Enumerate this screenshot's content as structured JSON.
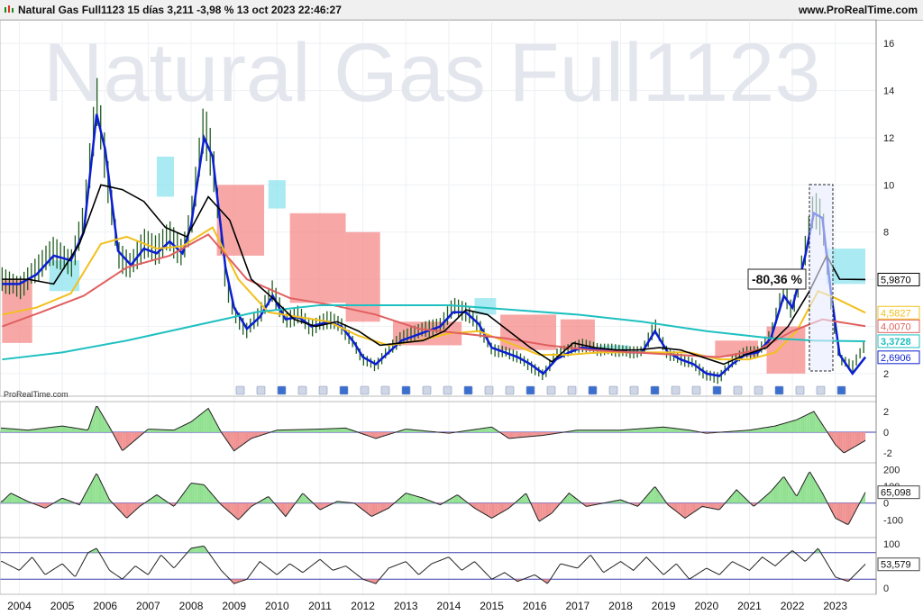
{
  "header": {
    "title": "Natural Gas Full1123 15 días 3,211 -3,98 % 13 oct 2023 22:46:27",
    "site": "www.ProRealTime.com",
    "watermark": "Natural Gas Full1123",
    "credit": "ProRealTime.com"
  },
  "chart_data": [
    {
      "type": "line",
      "panel": "price",
      "title": "Natural Gas Full1123",
      "x_unit": "year",
      "ylim": [
        1.5,
        17
      ],
      "y_ticks": [
        "2",
        "4",
        "6",
        "8",
        "10",
        "12",
        "14",
        "16"
      ],
      "x_ticks": [
        "2004",
        "2005",
        "2006",
        "2007",
        "2008",
        "2009",
        "2010",
        "2011",
        "2012",
        "2013",
        "2014",
        "2015",
        "2016",
        "2017",
        "2018",
        "2019",
        "2020",
        "2021",
        "2022",
        "2023"
      ],
      "series": [
        {
          "name": "price",
          "color": "#1f5c1f",
          "x": [
            2003.6,
            2004.0,
            2004.4,
            2004.8,
            2005.2,
            2005.5,
            2005.8,
            2006.0,
            2006.3,
            2006.6,
            2006.9,
            2007.2,
            2007.5,
            2007.8,
            2008.0,
            2008.3,
            2008.5,
            2008.8,
            2009.0,
            2009.3,
            2009.6,
            2009.9,
            2010.2,
            2010.5,
            2010.8,
            2011.2,
            2011.5,
            2011.8,
            2012.0,
            2012.3,
            2012.6,
            2012.9,
            2013.2,
            2013.5,
            2013.8,
            2014.1,
            2014.4,
            2014.7,
            2015.0,
            2015.3,
            2015.6,
            2015.9,
            2016.2,
            2016.5,
            2016.8,
            2017.1,
            2017.5,
            2017.8,
            2018.2,
            2018.5,
            2018.8,
            2019.1,
            2019.4,
            2019.7,
            2020.0,
            2020.3,
            2020.6,
            2020.9,
            2021.2,
            2021.5,
            2021.8,
            2022.0,
            2022.3,
            2022.5,
            2022.7,
            2022.9,
            2023.1,
            2023.4,
            2023.7
          ],
          "y": [
            6.0,
            5.6,
            6.4,
            7.2,
            6.6,
            8.5,
            13.5,
            11.0,
            7.0,
            6.5,
            7.5,
            7.2,
            7.8,
            7.0,
            8.5,
            12.5,
            11.0,
            6.0,
            4.5,
            3.8,
            4.5,
            5.5,
            4.2,
            4.5,
            3.9,
            4.3,
            4.0,
            3.2,
            2.6,
            2.3,
            3.0,
            3.5,
            3.7,
            3.9,
            4.0,
            4.8,
            4.6,
            4.0,
            3.0,
            2.9,
            2.7,
            2.3,
            1.9,
            2.8,
            3.0,
            3.2,
            3.0,
            3.0,
            2.9,
            2.9,
            4.0,
            2.8,
            2.6,
            2.4,
            1.9,
            1.8,
            2.5,
            2.9,
            2.9,
            3.6,
            5.6,
            4.5,
            7.2,
            9.0,
            8.5,
            5.0,
            2.6,
            2.3,
            3.2
          ]
        },
        {
          "name": "MA1",
          "color": "#0b1fd1",
          "x": [
            2003.6,
            2004.0,
            2004.4,
            2004.8,
            2005.2,
            2005.5,
            2005.8,
            2006.0,
            2006.3,
            2006.6,
            2006.9,
            2007.2,
            2007.5,
            2007.8,
            2008.0,
            2008.3,
            2008.5,
            2008.8,
            2009.0,
            2009.3,
            2009.6,
            2009.9,
            2010.2,
            2010.5,
            2010.8,
            2011.2,
            2011.5,
            2011.8,
            2012.0,
            2012.3,
            2012.6,
            2012.9,
            2013.2,
            2013.5,
            2013.8,
            2014.1,
            2014.4,
            2014.7,
            2015.0,
            2015.3,
            2015.6,
            2015.9,
            2016.2,
            2016.5,
            2016.8,
            2017.1,
            2017.5,
            2017.8,
            2018.2,
            2018.5,
            2018.8,
            2019.1,
            2019.4,
            2019.7,
            2020.0,
            2020.3,
            2020.6,
            2020.9,
            2021.2,
            2021.5,
            2021.8,
            2022.0,
            2022.3,
            2022.5,
            2022.7,
            2022.9,
            2023.1,
            2023.4,
            2023.7
          ],
          "y": [
            5.8,
            5.8,
            6.2,
            7.0,
            6.8,
            8.0,
            13.0,
            11.5,
            7.2,
            6.6,
            7.3,
            7.1,
            7.6,
            7.1,
            8.3,
            12.0,
            11.2,
            6.5,
            4.8,
            3.9,
            4.4,
            5.3,
            4.3,
            4.4,
            4.0,
            4.2,
            4.0,
            3.3,
            2.7,
            2.4,
            2.9,
            3.4,
            3.6,
            3.8,
            4.0,
            4.6,
            4.6,
            4.1,
            3.1,
            2.9,
            2.7,
            2.4,
            2.0,
            2.6,
            2.9,
            3.1,
            3.0,
            3.0,
            2.9,
            2.9,
            3.8,
            2.9,
            2.6,
            2.4,
            2.0,
            1.9,
            2.4,
            2.8,
            2.9,
            3.5,
            5.3,
            4.8,
            7.0,
            8.8,
            8.6,
            5.4,
            2.8,
            2.0,
            2.7
          ]
        },
        {
          "name": "MA2",
          "color": "#f2c01d",
          "x": [
            2003.6,
            2004.4,
            2005.2,
            2005.9,
            2006.5,
            2007.2,
            2007.8,
            2008.5,
            2009.1,
            2009.8,
            2010.5,
            2011.2,
            2011.9,
            2012.6,
            2013.3,
            2014.0,
            2014.7,
            2015.4,
            2016.1,
            2016.8,
            2017.5,
            2018.2,
            2018.9,
            2019.6,
            2020.3,
            2021.0,
            2021.6,
            2022.1,
            2022.6,
            2023.0,
            2023.7
          ],
          "y": [
            4.5,
            4.8,
            5.4,
            7.5,
            7.8,
            7.3,
            7.4,
            8.2,
            6.0,
            4.6,
            4.4,
            4.2,
            3.6,
            3.2,
            3.4,
            3.7,
            3.8,
            3.3,
            2.8,
            2.8,
            2.9,
            2.9,
            2.9,
            2.9,
            2.6,
            2.6,
            2.9,
            3.8,
            5.5,
            5.2,
            4.58
          ]
        },
        {
          "name": "MA3",
          "color": "#e06060",
          "x": [
            2003.6,
            2004.5,
            2005.5,
            2006.5,
            2007.5,
            2008.4,
            2009.3,
            2010.3,
            2011.3,
            2012.3,
            2013.3,
            2014.3,
            2015.3,
            2016.3,
            2017.3,
            2018.3,
            2019.3,
            2020.3,
            2021.2,
            2022.0,
            2022.7,
            2023.7
          ],
          "y": [
            4.0,
            4.6,
            5.3,
            6.5,
            7.0,
            7.9,
            6.0,
            5.2,
            4.9,
            4.5,
            3.9,
            3.7,
            3.5,
            3.2,
            3.0,
            2.9,
            2.8,
            2.7,
            3.0,
            3.8,
            4.3,
            4.01
          ]
        },
        {
          "name": "MA4",
          "color": "#1fc0c0",
          "x": [
            2003.6,
            2005.0,
            2006.5,
            2008.0,
            2009.5,
            2011.0,
            2012.5,
            2014.0,
            2015.5,
            2017.0,
            2018.5,
            2020.0,
            2021.5,
            2022.5,
            2023.7
          ],
          "y": [
            2.6,
            2.9,
            3.4,
            4.0,
            4.6,
            4.9,
            4.9,
            4.9,
            4.7,
            4.5,
            4.2,
            3.8,
            3.5,
            3.4,
            3.37
          ]
        },
        {
          "name": "kijun",
          "color": "#000000",
          "x": [
            2003.6,
            2004.2,
            2004.8,
            2005.4,
            2005.9,
            2006.4,
            2006.9,
            2007.4,
            2007.9,
            2008.4,
            2008.9,
            2009.4,
            2009.9,
            2010.4,
            2010.9,
            2011.4,
            2011.9,
            2012.4,
            2012.9,
            2013.4,
            2013.9,
            2014.4,
            2014.9,
            2015.4,
            2015.9,
            2016.4,
            2016.9,
            2017.4,
            2017.9,
            2018.4,
            2018.9,
            2019.4,
            2019.9,
            2020.4,
            2020.9,
            2021.4,
            2021.9,
            2022.4,
            2022.8,
            2023.1,
            2023.7
          ],
          "y": [
            6.0,
            6.0,
            5.8,
            7.5,
            10.0,
            9.8,
            9.3,
            8.2,
            7.8,
            9.5,
            8.5,
            6.0,
            5.2,
            4.3,
            4.0,
            4.2,
            3.8,
            3.2,
            3.3,
            3.4,
            3.8,
            4.7,
            4.5,
            3.8,
            3.1,
            2.5,
            3.3,
            3.1,
            3.0,
            3.0,
            3.1,
            3.0,
            2.7,
            2.4,
            2.8,
            3.1,
            4.0,
            5.5,
            7.0,
            6.0,
            5.99
          ]
        }
      ],
      "cloud": [
        {
          "type": "bear",
          "x": [
            2003.6,
            2004.3
          ],
          "low": 3.3,
          "high": 6.0
        },
        {
          "type": "bull",
          "x": [
            2004.7,
            2005.4
          ],
          "low": 5.5,
          "high": 6.8
        },
        {
          "type": "bull",
          "x": [
            2007.2,
            2007.6
          ],
          "low": 9.5,
          "high": 11.2
        },
        {
          "type": "bear",
          "x": [
            2008.6,
            2009.7
          ],
          "low": 7.0,
          "high": 10.0
        },
        {
          "type": "bull",
          "x": [
            2009.8,
            2010.2
          ],
          "low": 9.0,
          "high": 10.2
        },
        {
          "type": "bear",
          "x": [
            2010.3,
            2011.6
          ],
          "low": 5.0,
          "high": 8.8
        },
        {
          "type": "bear",
          "x": [
            2011.6,
            2012.4
          ],
          "low": 4.2,
          "high": 8.0
        },
        {
          "type": "bear",
          "x": [
            2012.7,
            2014.3
          ],
          "low": 3.2,
          "high": 4.2
        },
        {
          "type": "bull",
          "x": [
            2014.6,
            2015.1
          ],
          "low": 4.5,
          "high": 5.2
        },
        {
          "type": "bear",
          "x": [
            2015.2,
            2016.5
          ],
          "low": 3.0,
          "high": 4.5
        },
        {
          "type": "bear",
          "x": [
            2016.6,
            2017.4
          ],
          "low": 3.0,
          "high": 4.3
        },
        {
          "type": "bull",
          "x": [
            2017.5,
            2018.2
          ],
          "low": 2.9,
          "high": 3.2
        },
        {
          "type": "bear",
          "x": [
            2020.2,
            2021.2
          ],
          "low": 2.7,
          "high": 3.4
        },
        {
          "type": "bear",
          "x": [
            2021.4,
            2022.3
          ],
          "low": 2.0,
          "high": 4.0
        },
        {
          "type": "bull",
          "x": [
            2022.8,
            2023.7
          ],
          "low": 5.8,
          "high": 7.3
        }
      ],
      "price_labels": [
        {
          "value": "5,9870",
          "color": "#000000"
        },
        {
          "value": "4,5827",
          "color": "#f2c01d"
        },
        {
          "value": "4,0070",
          "color": "#e06060"
        },
        {
          "value": "3,3728",
          "color": "#1fc0c0"
        },
        {
          "value": "2,6906",
          "color": "#0b1fd1"
        }
      ],
      "annotation": "-80,36 %"
    },
    {
      "type": "area",
      "panel": "oscillator-1",
      "ylim": [
        -2.6,
        2.6
      ],
      "y_ticks": [
        "2",
        "0",
        "-2"
      ],
      "x": [
        2003.6,
        2004.2,
        2005.0,
        2005.6,
        2005.8,
        2006.1,
        2006.4,
        2007.0,
        2007.6,
        2008.0,
        2008.4,
        2008.7,
        2009.0,
        2009.4,
        2010.0,
        2011.0,
        2011.6,
        2012.3,
        2013.0,
        2014.0,
        2015.0,
        2015.4,
        2016.2,
        2017.0,
        2018.0,
        2019.0,
        2019.6,
        2020.0,
        2021.0,
        2021.6,
        2022.1,
        2022.5,
        2022.8,
        2023.0,
        2023.2,
        2023.7
      ],
      "y": [
        0.4,
        0.2,
        0.6,
        0.2,
        2.6,
        0.5,
        -1.8,
        0.3,
        0.2,
        1.0,
        2.3,
        0.0,
        -1.8,
        -0.6,
        0.2,
        0.3,
        0.4,
        -0.6,
        0.3,
        -0.1,
        0.5,
        -0.6,
        -0.3,
        0.2,
        0.2,
        0.5,
        0.2,
        -0.1,
        0.2,
        0.6,
        1.2,
        2.0,
        0.1,
        -1.2,
        -2.0,
        -0.8
      ]
    },
    {
      "type": "area",
      "panel": "oscillator-2",
      "ylim": [
        -190,
        225
      ],
      "y_ticks": [
        "200",
        "100",
        "0",
        "-100"
      ],
      "value_label": "65,098",
      "x": [
        2003.6,
        2003.8,
        2004.2,
        2004.6,
        2005.0,
        2005.4,
        2005.8,
        2006.1,
        2006.5,
        2006.8,
        2007.2,
        2007.6,
        2008.0,
        2008.3,
        2008.7,
        2009.1,
        2009.4,
        2009.8,
        2010.2,
        2010.6,
        2011.0,
        2011.4,
        2011.8,
        2012.2,
        2012.6,
        2013.0,
        2013.4,
        2013.8,
        2014.2,
        2014.6,
        2015.0,
        2015.4,
        2015.8,
        2016.1,
        2016.4,
        2016.8,
        2017.2,
        2017.6,
        2018.0,
        2018.4,
        2018.8,
        2019.1,
        2019.5,
        2019.9,
        2020.3,
        2020.7,
        2021.1,
        2021.5,
        2021.8,
        2022.1,
        2022.4,
        2022.7,
        2023.0,
        2023.3,
        2023.7
      ],
      "y": [
        10,
        60,
        10,
        -30,
        30,
        -10,
        180,
        20,
        -90,
        -20,
        50,
        -20,
        120,
        110,
        -10,
        -100,
        -20,
        40,
        -80,
        60,
        -40,
        10,
        0,
        -80,
        -30,
        60,
        30,
        -10,
        50,
        -30,
        -90,
        -30,
        60,
        -110,
        -60,
        60,
        -20,
        0,
        20,
        -20,
        100,
        -10,
        -90,
        -20,
        -40,
        80,
        -20,
        70,
        160,
        40,
        190,
        60,
        -90,
        -130,
        65
      ]
    },
    {
      "type": "line",
      "panel": "oscillator-3",
      "ylim": [
        -8,
        108
      ],
      "y_ticks": [
        "100",
        "0"
      ],
      "levels": [
        80,
        20
      ],
      "value_label": "53,579",
      "x": [
        2003.6,
        2004.0,
        2004.3,
        2004.6,
        2005.0,
        2005.3,
        2005.6,
        2005.8,
        2006.1,
        2006.4,
        2006.7,
        2007.0,
        2007.3,
        2007.6,
        2008.0,
        2008.3,
        2008.7,
        2009.0,
        2009.3,
        2009.6,
        2010.0,
        2010.3,
        2010.6,
        2011.0,
        2011.3,
        2011.6,
        2012.0,
        2012.3,
        2012.6,
        2013.0,
        2013.3,
        2013.6,
        2014.0,
        2014.3,
        2014.6,
        2015.0,
        2015.3,
        2015.6,
        2016.0,
        2016.3,
        2016.6,
        2017.0,
        2017.3,
        2017.6,
        2018.0,
        2018.3,
        2018.6,
        2019.0,
        2019.3,
        2019.6,
        2020.0,
        2020.3,
        2020.6,
        2021.0,
        2021.3,
        2021.6,
        2022.0,
        2022.3,
        2022.6,
        2023.0,
        2023.3,
        2023.7
      ],
      "y": [
        60,
        40,
        70,
        30,
        55,
        25,
        80,
        90,
        40,
        20,
        50,
        30,
        75,
        45,
        90,
        95,
        40,
        10,
        20,
        60,
        30,
        55,
        35,
        65,
        40,
        50,
        20,
        10,
        45,
        60,
        30,
        55,
        70,
        40,
        60,
        20,
        35,
        15,
        30,
        10,
        55,
        45,
        75,
        35,
        60,
        40,
        70,
        30,
        55,
        20,
        45,
        30,
        60,
        40,
        70,
        50,
        85,
        60,
        90,
        25,
        15,
        54
      ]
    }
  ]
}
